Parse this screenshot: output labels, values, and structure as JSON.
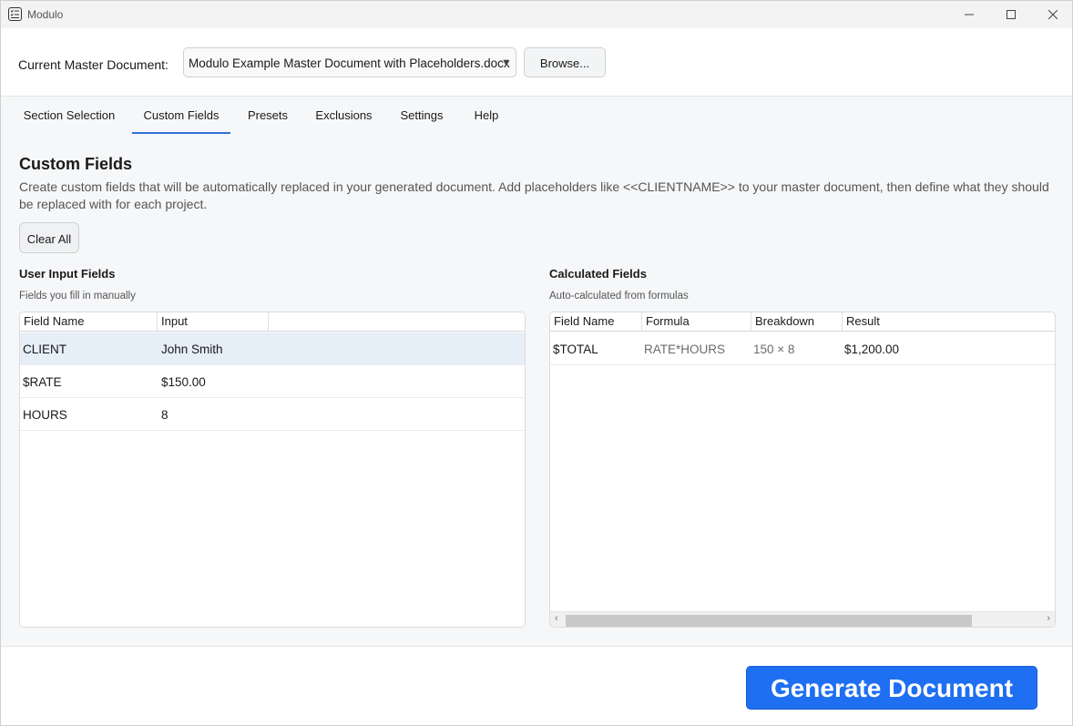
{
  "window": {
    "title": "Modulo",
    "app_icon": "checklist-icon",
    "controls": [
      "minimize-icon",
      "maximize-icon",
      "close-icon"
    ]
  },
  "master_document": {
    "label": "Current Master Document:",
    "selected": "Modulo Example Master Document with Placeholders.docx",
    "browse_label": "Browse..."
  },
  "tabs": [
    {
      "label": "Section Selection",
      "active": false
    },
    {
      "label": "Custom Fields",
      "active": true
    },
    {
      "label": "Presets",
      "active": false
    },
    {
      "label": "Exclusions",
      "active": false
    },
    {
      "label": "Settings",
      "active": false
    },
    {
      "label": "Help",
      "active": false
    }
  ],
  "custom_fields": {
    "title": "Custom Fields",
    "description": "Create custom fields that will be automatically replaced in your generated document. Add placeholders like <<CLIENTNAME>> to your master document, then define what they should be replaced with for each project.",
    "clear_all_label": "Clear All"
  },
  "user_input": {
    "title": "User Input Fields",
    "subtitle": "Fields you fill in manually",
    "columns": [
      "Field Name",
      "Input"
    ],
    "rows": [
      {
        "field": "CLIENT",
        "input": "John Smith"
      },
      {
        "field": "$RATE",
        "input": "$150.00"
      },
      {
        "field": "HOURS",
        "input": "8"
      }
    ]
  },
  "calculated": {
    "title": "Calculated Fields",
    "subtitle": "Auto-calculated from formulas",
    "columns": [
      "Field Name",
      "Formula",
      "Breakdown",
      "Result"
    ],
    "rows": [
      {
        "field": "$TOTAL",
        "formula": "RATE*HOURS",
        "breakdown": "150 × 8",
        "result": "$1,200.00"
      }
    ]
  },
  "footer": {
    "generate_label": "Generate Document"
  },
  "colors": {
    "accent": "#1f6ff2",
    "selected_row": "#e6eef8"
  }
}
